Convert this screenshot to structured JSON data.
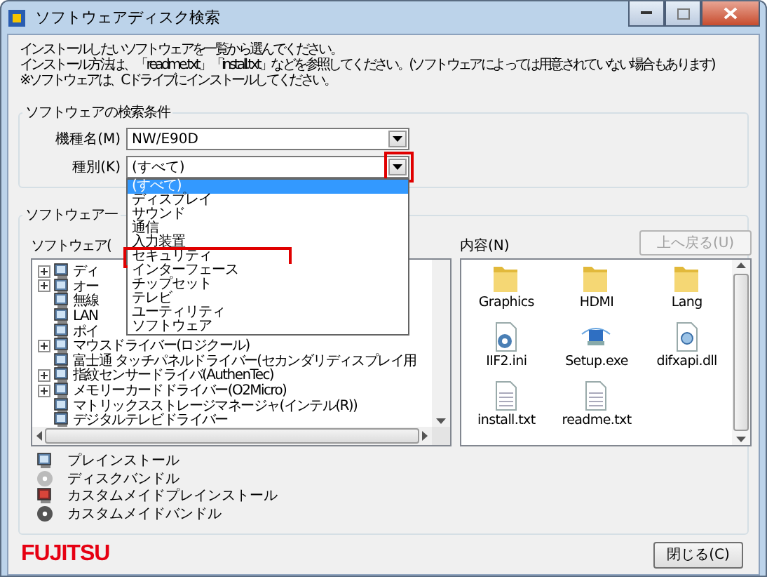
{
  "window": {
    "title": "ソフトウェアディスク検索"
  },
  "instructions": [
    "インストールしたいソフトウェアを一覧から選んでください。",
    "インストール方法は、「readme.txt」「install.txt」などを参照してください。(ソフトウェアによっては用意されていない場合もあります)",
    "※ソフトウェアは、Cドライブにインストールしてください。"
  ],
  "search_conditions": {
    "title": "ソフトウェアの検索条件",
    "model": {
      "label": "機種名(M)",
      "value": "NW/E90D"
    },
    "category": {
      "label": "種別(K)",
      "value": "(すべて)",
      "arrow_highlighted": true,
      "options": [
        {
          "label": "(すべて)",
          "selected": true,
          "highlighted": false
        },
        {
          "label": "ディスプレイ",
          "selected": false,
          "highlighted": false
        },
        {
          "label": "サウンド",
          "selected": false,
          "highlighted": false
        },
        {
          "label": "通信",
          "selected": false,
          "highlighted": false
        },
        {
          "label": "入力装置",
          "selected": false,
          "highlighted": false
        },
        {
          "label": "セキュリティ",
          "selected": false,
          "highlighted": true
        },
        {
          "label": "インターフェース",
          "selected": false,
          "highlighted": false
        },
        {
          "label": "チップセット",
          "selected": false,
          "highlighted": false
        },
        {
          "label": "テレビ",
          "selected": false,
          "highlighted": false
        },
        {
          "label": "ユーティリティ",
          "selected": false,
          "highlighted": false
        },
        {
          "label": "ソフトウェア",
          "selected": false,
          "highlighted": false
        }
      ]
    }
  },
  "software_list": {
    "title": "ソフトウェア一",
    "tree_label": "ソフトウェア(",
    "tree": [
      {
        "label": "ディ",
        "expandable": true
      },
      {
        "label": "オー",
        "expandable": true
      },
      {
        "label": "無線",
        "expandable": false
      },
      {
        "label": "LAN",
        "expandable": false
      },
      {
        "label": "ポイ",
        "expandable": false
      },
      {
        "label": "マウスドライバー(ロジクール)",
        "expandable": true
      },
      {
        "label": "富士通 タッチパネルドライバー(セカンダリディスプレイ用",
        "expandable": false
      },
      {
        "label": "指紋センサードライバ(AuthenTec)",
        "expandable": true
      },
      {
        "label": "メモリーカードドライバー(O2Micro)",
        "expandable": true
      },
      {
        "label": "マトリックスストレージマネージャ(インテル(R))",
        "expandable": false
      },
      {
        "label": "デジタルテレビドライバー",
        "expandable": false
      }
    ],
    "contents_label": "内容(N)",
    "up_button": {
      "label": "上へ戻る(U)",
      "disabled": true
    },
    "contents": [
      {
        "name": "Graphics",
        "kind": "folder"
      },
      {
        "name": "HDMI",
        "kind": "folder"
      },
      {
        "name": "Lang",
        "kind": "folder"
      },
      {
        "name": "IIF2.ini",
        "kind": "settings"
      },
      {
        "name": "Setup.exe",
        "kind": "setup"
      },
      {
        "name": "difxapi.dll",
        "kind": "library"
      },
      {
        "name": "install.txt",
        "kind": "text"
      },
      {
        "name": "readme.txt",
        "kind": "text"
      }
    ],
    "legend": [
      {
        "label": "プレインストール",
        "kind": "preinstall"
      },
      {
        "label": "ディスクバンドル",
        "kind": "bundle"
      },
      {
        "label": "カスタムメイドプレインストール",
        "kind": "custompreinstall"
      },
      {
        "label": "カスタムメイドバンドル",
        "kind": "custombundle"
      }
    ]
  },
  "footer": {
    "logo": "FUJITSU",
    "close_button": "閉じる(C)"
  }
}
